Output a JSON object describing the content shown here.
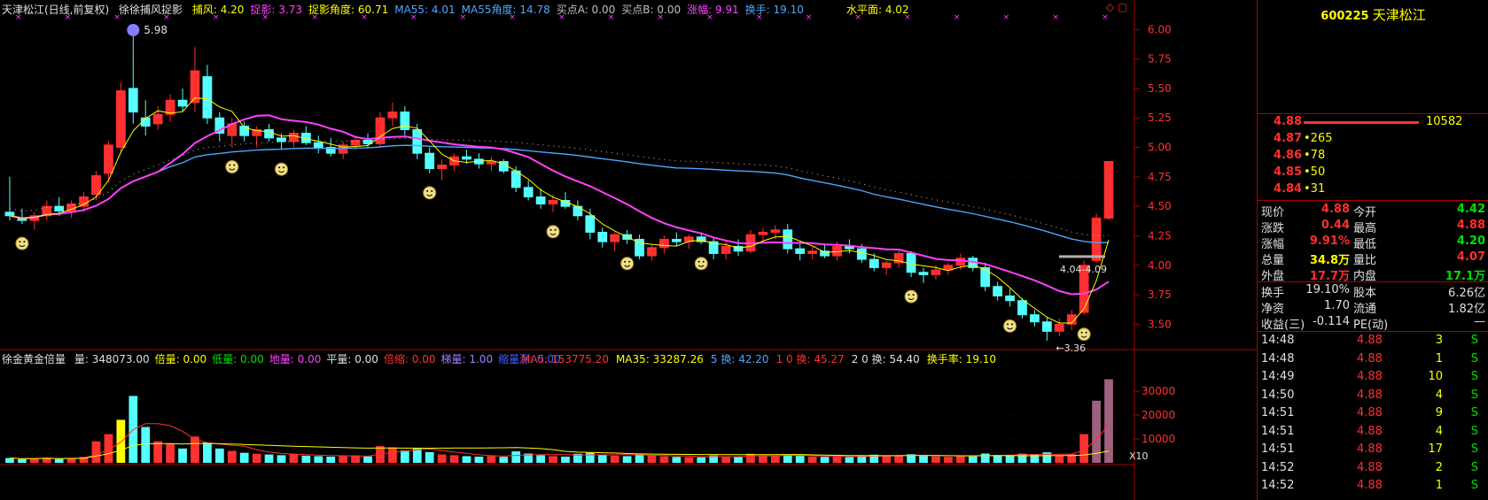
{
  "title": "天津松江(日线,前复权)",
  "indicator_name": "徐徐捕风捉影",
  "main_legend": [
    {
      "label": "捕风: 4.20",
      "color": "#ffff00"
    },
    {
      "label": "捉影: 3.73",
      "color": "#ff40ff"
    },
    {
      "label": "捉影角度: 60.71",
      "color": "#ffff00"
    },
    {
      "label": "MA55: 4.01",
      "color": "#4da6ff"
    },
    {
      "label": "MA55角度: 14.78",
      "color": "#4da6ff"
    },
    {
      "label": "买点A: 0.00",
      "color": "#c0c0c0"
    },
    {
      "label": "买点B: 0.00",
      "color": "#c0c0c0"
    },
    {
      "label": "涨幅: 9.91",
      "color": "#ff40ff"
    },
    {
      "label": "换手: 19.10",
      "color": "#4da6ff"
    }
  ],
  "water_level": "水平面: 4.02",
  "volume_indicator_name": "徐金黄金倍量",
  "volume_legend": [
    {
      "label": "量: 348073.00",
      "color": "#e0e0e0"
    },
    {
      "label": "倍量: 0.00",
      "color": "#ffff00"
    },
    {
      "label": "低量: 0.00",
      "color": "#00e000"
    },
    {
      "label": "地量: 0.00",
      "color": "#ff40ff"
    },
    {
      "label": "平量: 0.00",
      "color": "#e0e0e0"
    },
    {
      "label": "倍缩: 0.00",
      "color": "#ff3030"
    },
    {
      "label": "梯量: 1.00",
      "color": "#a080ff"
    },
    {
      "label": "缩量涨: 0.00",
      "color": "#4060ff"
    }
  ],
  "volume_ma_legend": [
    {
      "label": "MA5: 153775.20",
      "color": "#ff3030"
    },
    {
      "label": "MA35: 33287.26",
      "color": "#ffff00"
    },
    {
      "label": "5 换: 42.20",
      "color": "#4da6ff"
    },
    {
      "label": "1 0 换: 45.27",
      "color": "#ff3030"
    },
    {
      "label": "2 0 换: 54.40",
      "color": "#e0e0e0"
    },
    {
      "label": "换手率: 19.10",
      "color": "#ffff00"
    }
  ],
  "price_axis": [
    "6.00",
    "5.75",
    "5.50",
    "5.25",
    "5.00",
    "4.75",
    "4.50",
    "4.25",
    "4.00",
    "3.75",
    "3.50"
  ],
  "volume_axis": [
    "30000",
    "20000",
    "10000"
  ],
  "annotations": {
    "high": "5.98",
    "low": "3.36",
    "range": "4.04-4.09",
    "x10": "X10"
  },
  "chart_data": {
    "type": "candlestick",
    "ylim": [
      3.3,
      6.1
    ],
    "ohlc": [
      [
        4.45,
        4.75,
        4.38,
        4.42
      ],
      [
        4.4,
        4.48,
        4.35,
        4.38
      ],
      [
        4.38,
        4.45,
        4.3,
        4.42
      ],
      [
        4.42,
        4.55,
        4.38,
        4.5
      ],
      [
        4.5,
        4.58,
        4.42,
        4.46
      ],
      [
        4.46,
        4.55,
        4.4,
        4.52
      ],
      [
        4.5,
        4.62,
        4.45,
        4.58
      ],
      [
        4.6,
        4.8,
        4.55,
        4.76
      ],
      [
        4.78,
        5.05,
        4.7,
        5.02
      ],
      [
        5.0,
        5.55,
        4.95,
        5.48
      ],
      [
        5.5,
        5.98,
        5.2,
        5.3
      ],
      [
        5.25,
        5.4,
        5.1,
        5.18
      ],
      [
        5.2,
        5.35,
        5.15,
        5.28
      ],
      [
        5.28,
        5.45,
        5.22,
        5.4
      ],
      [
        5.4,
        5.5,
        5.3,
        5.35
      ],
      [
        5.38,
        5.85,
        5.3,
        5.65
      ],
      [
        5.6,
        5.7,
        5.2,
        5.25
      ],
      [
        5.25,
        5.3,
        5.05,
        5.12
      ],
      [
        5.1,
        5.25,
        5.0,
        5.2
      ],
      [
        5.18,
        5.22,
        5.05,
        5.1
      ],
      [
        5.1,
        5.18,
        5.0,
        5.15
      ],
      [
        5.15,
        5.2,
        5.05,
        5.08
      ],
      [
        5.08,
        5.12,
        4.98,
        5.05
      ],
      [
        5.05,
        5.15,
        5.0,
        5.12
      ],
      [
        5.12,
        5.18,
        5.02,
        5.04
      ],
      [
        5.04,
        5.1,
        4.95,
        5.0
      ],
      [
        5.0,
        5.08,
        4.92,
        4.95
      ],
      [
        4.95,
        5.05,
        4.9,
        5.02
      ],
      [
        5.02,
        5.1,
        4.98,
        5.06
      ],
      [
        5.06,
        5.12,
        5.0,
        5.03
      ],
      [
        5.03,
        5.3,
        5.0,
        5.25
      ],
      [
        5.25,
        5.38,
        5.18,
        5.3
      ],
      [
        5.3,
        5.35,
        5.1,
        5.15
      ],
      [
        5.15,
        5.2,
        4.9,
        4.95
      ],
      [
        4.95,
        5.0,
        4.78,
        4.82
      ],
      [
        4.82,
        4.9,
        4.72,
        4.85
      ],
      [
        4.85,
        4.95,
        4.8,
        4.92
      ],
      [
        4.92,
        4.98,
        4.86,
        4.9
      ],
      [
        4.9,
        4.95,
        4.82,
        4.86
      ],
      [
        4.86,
        4.92,
        4.8,
        4.88
      ],
      [
        4.88,
        4.9,
        4.78,
        4.8
      ],
      [
        4.8,
        4.84,
        4.62,
        4.66
      ],
      [
        4.66,
        4.72,
        4.55,
        4.58
      ],
      [
        4.58,
        4.65,
        4.48,
        4.52
      ],
      [
        4.52,
        4.6,
        4.45,
        4.55
      ],
      [
        4.55,
        4.62,
        4.48,
        4.5
      ],
      [
        4.5,
        4.55,
        4.38,
        4.42
      ],
      [
        4.42,
        4.48,
        4.22,
        4.28
      ],
      [
        4.28,
        4.32,
        4.15,
        4.2
      ],
      [
        4.2,
        4.28,
        4.12,
        4.26
      ],
      [
        4.26,
        4.3,
        4.18,
        4.22
      ],
      [
        4.22,
        4.26,
        4.05,
        4.08
      ],
      [
        4.08,
        4.18,
        4.04,
        4.15
      ],
      [
        4.15,
        4.25,
        4.1,
        4.22
      ],
      [
        4.22,
        4.28,
        4.16,
        4.2
      ],
      [
        4.2,
        4.26,
        4.14,
        4.24
      ],
      [
        4.24,
        4.28,
        4.18,
        4.2
      ],
      [
        4.2,
        4.24,
        4.05,
        4.1
      ],
      [
        4.1,
        4.2,
        4.05,
        4.16
      ],
      [
        4.16,
        4.22,
        4.08,
        4.12
      ],
      [
        4.12,
        4.3,
        4.1,
        4.26
      ],
      [
        4.26,
        4.32,
        4.2,
        4.28
      ],
      [
        4.28,
        4.34,
        4.22,
        4.3
      ],
      [
        4.3,
        4.35,
        4.1,
        4.14
      ],
      [
        4.14,
        4.18,
        4.04,
        4.1
      ],
      [
        4.1,
        4.16,
        4.05,
        4.12
      ],
      [
        4.12,
        4.18,
        4.06,
        4.08
      ],
      [
        4.08,
        4.2,
        4.04,
        4.16
      ],
      [
        4.16,
        4.22,
        4.1,
        4.14
      ],
      [
        4.14,
        4.18,
        4.02,
        4.05
      ],
      [
        4.05,
        4.1,
        3.95,
        3.98
      ],
      [
        3.98,
        4.04,
        3.92,
        4.02
      ],
      [
        4.02,
        4.14,
        3.98,
        4.1
      ],
      [
        4.1,
        4.12,
        3.9,
        3.94
      ],
      [
        3.94,
        3.98,
        3.85,
        3.92
      ],
      [
        3.92,
        4.0,
        3.88,
        3.96
      ],
      [
        3.96,
        4.02,
        3.92,
        4.0
      ],
      [
        4.0,
        4.1,
        3.96,
        4.06
      ],
      [
        4.06,
        4.08,
        3.95,
        3.98
      ],
      [
        3.98,
        4.02,
        3.78,
        3.82
      ],
      [
        3.82,
        3.86,
        3.7,
        3.74
      ],
      [
        3.74,
        3.8,
        3.65,
        3.7
      ],
      [
        3.7,
        3.72,
        3.55,
        3.58
      ],
      [
        3.58,
        3.62,
        3.48,
        3.52
      ],
      [
        3.52,
        3.56,
        3.36,
        3.44
      ],
      [
        3.44,
        3.55,
        3.4,
        3.5
      ],
      [
        3.5,
        3.62,
        3.45,
        3.58
      ],
      [
        3.6,
        4.04,
        3.58,
        4.0
      ],
      [
        4.04,
        4.44,
        4.02,
        4.4
      ],
      [
        4.4,
        4.88,
        4.38,
        4.88
      ]
    ],
    "volume": [
      2000,
      1500,
      1800,
      2200,
      1600,
      1900,
      2500,
      9000,
      12000,
      18000,
      28000,
      15000,
      9000,
      8000,
      6000,
      11000,
      8500,
      6000,
      5000,
      4200,
      3800,
      3500,
      3200,
      3600,
      3000,
      2800,
      2600,
      2900,
      3100,
      2700,
      7000,
      6500,
      5200,
      6000,
      4500,
      3500,
      3200,
      2800,
      2600,
      2900,
      2500,
      4800,
      3900,
      3200,
      2800,
      2600,
      3800,
      4200,
      3300,
      3000,
      2800,
      3600,
      3000,
      2700,
      2500,
      2400,
      2300,
      3100,
      2600,
      2400,
      3800,
      3000,
      2800,
      3500,
      2900,
      2600,
      2500,
      2700,
      2400,
      3000,
      3400,
      2800,
      3200,
      3600,
      2900,
      2700,
      2500,
      2800,
      3100,
      3900,
      3300,
      3100,
      3800,
      3500,
      4400,
      3000,
      3600,
      12000,
      26000,
      35000
    ],
    "vol_ylim": [
      0,
      40000
    ]
  },
  "sidebar": {
    "code": "600225",
    "name": "天津松江",
    "order_top": {
      "price": "4.88",
      "qty": "10582"
    },
    "bids": [
      {
        "price": "4.87",
        "qty": "265"
      },
      {
        "price": "4.86",
        "qty": "78"
      },
      {
        "price": "4.85",
        "qty": "50"
      },
      {
        "price": "4.84",
        "qty": "31"
      }
    ],
    "stats": [
      {
        "l1": "现价",
        "v1": "4.88",
        "c1": "#ff3030",
        "l2": "今开",
        "v2": "4.42",
        "c2": "#00e000"
      },
      {
        "l1": "涨跌",
        "v1": "0.44",
        "c1": "#ff3030",
        "l2": "最高",
        "v2": "4.88",
        "c2": "#ff3030"
      },
      {
        "l1": "涨幅",
        "v1": "9.91%",
        "c1": "#ff3030",
        "l2": "最低",
        "v2": "4.20",
        "c2": "#00e000"
      },
      {
        "l1": "总量",
        "v1": "34.8万",
        "c1": "#ffff00",
        "l2": "量比",
        "v2": "4.07",
        "c2": "#ff3030"
      },
      {
        "l1": "外盘",
        "v1": "17.7万",
        "c1": "#ff3030",
        "l2": "内盘",
        "v2": "17.1万",
        "c2": "#00e000"
      }
    ],
    "stats2": [
      {
        "l1": "换手",
        "v1": "19.10%",
        "l2": "股本",
        "v2": "6.26亿"
      },
      {
        "l1": "净资",
        "v1": "1.70",
        "l2": "流通",
        "v2": "1.82亿"
      },
      {
        "l1": "收益(三)",
        "v1": "-0.114",
        "l2": "PE(动)",
        "v2": "—"
      }
    ],
    "ticks": [
      {
        "time": "14:48",
        "price": "4.88",
        "vol": "3",
        "side": "S"
      },
      {
        "time": "14:48",
        "price": "4.88",
        "vol": "1",
        "side": "S"
      },
      {
        "time": "14:49",
        "price": "4.88",
        "vol": "10",
        "side": "S"
      },
      {
        "time": "14:50",
        "price": "4.88",
        "vol": "4",
        "side": "S"
      },
      {
        "time": "14:51",
        "price": "4.88",
        "vol": "9",
        "side": "S"
      },
      {
        "time": "14:51",
        "price": "4.88",
        "vol": "4",
        "side": "S"
      },
      {
        "time": "14:51",
        "price": "4.88",
        "vol": "17",
        "side": "S"
      },
      {
        "time": "14:52",
        "price": "4.88",
        "vol": "2",
        "side": "S"
      },
      {
        "time": "14:52",
        "price": "4.88",
        "vol": "1",
        "side": "S"
      }
    ]
  }
}
